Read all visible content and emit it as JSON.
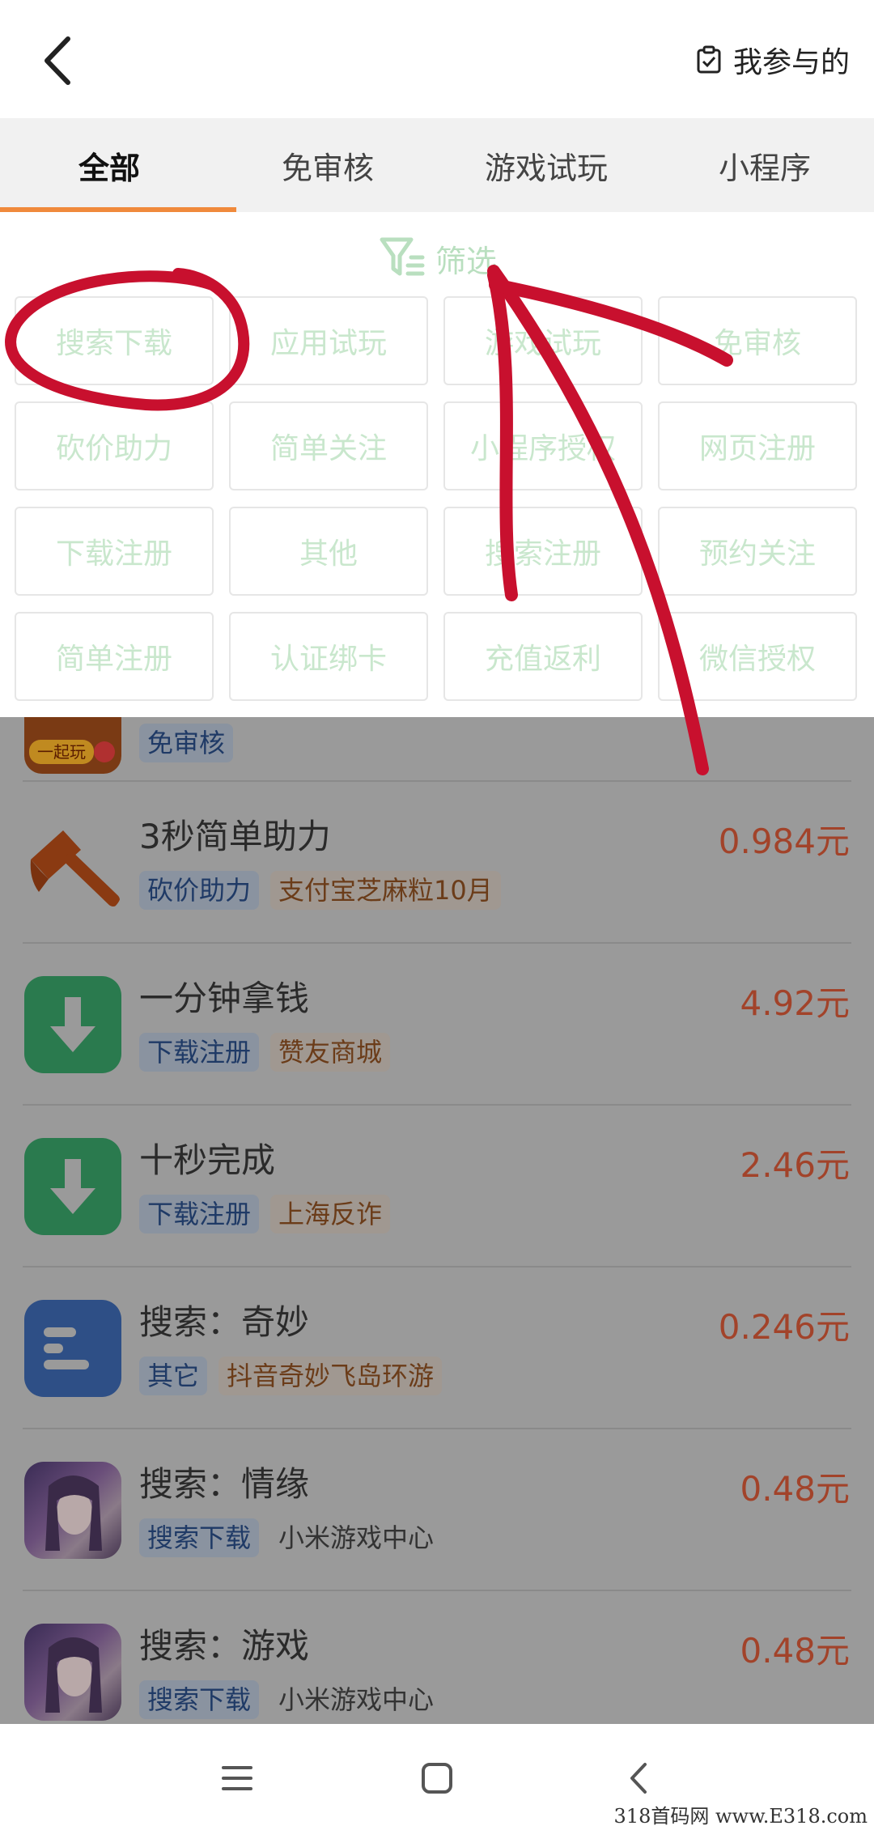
{
  "header": {
    "my_joined_label": "我参与的"
  },
  "tabs": [
    {
      "label": "全部",
      "active": true
    },
    {
      "label": "免审核",
      "active": false
    },
    {
      "label": "游戏试玩",
      "active": false
    },
    {
      "label": "小程序",
      "active": false
    }
  ],
  "filter": {
    "title": "筛选",
    "options": [
      "搜索下载",
      "应用试玩",
      "游戏试玩",
      "免审核",
      "砍价助力",
      "简单关注",
      "小程序授权",
      "网页注册",
      "下载注册",
      "其他",
      "搜索注册",
      "预约关注",
      "简单注册",
      "认证绑卡",
      "充值返利",
      "微信授权"
    ]
  },
  "list": {
    "partial_item": {
      "type_tag": "免审核",
      "icon_text": "一起玩"
    },
    "items": [
      {
        "title": "3秒简单助力",
        "price": "0.984元",
        "type_tag": "砍价助力",
        "sub_tag": "支付宝芝麻粒10月",
        "icon": "axe-icon"
      },
      {
        "title": "一分钟拿钱",
        "price": "4.92元",
        "type_tag": "下载注册",
        "sub_tag": "赞友商城",
        "icon": "download-icon"
      },
      {
        "title": "十秒完成",
        "price": "2.46元",
        "type_tag": "下载注册",
        "sub_tag": "上海反诈",
        "icon": "download-icon"
      },
      {
        "title": "搜索：奇妙",
        "price": "0.246元",
        "type_tag": "其它",
        "sub_tag": "抖音奇妙飞岛环游",
        "icon": "document-icon"
      },
      {
        "title": "搜索：情缘",
        "price": "0.48元",
        "type_tag": "搜索下载",
        "sub_tag": "小米游戏中心",
        "icon": "game-avatar-icon"
      },
      {
        "title": "搜索：游戏",
        "price": "0.48元",
        "type_tag": "搜索下载",
        "sub_tag": "小米游戏中心",
        "icon": "game-avatar-icon"
      }
    ]
  },
  "watermark": "318首码网 www.E318.com",
  "colors": {
    "accent": "#f08a3c",
    "price": "#a2432a",
    "filter_green": "#b9dfbf",
    "annotation_red": "#c8102e"
  }
}
